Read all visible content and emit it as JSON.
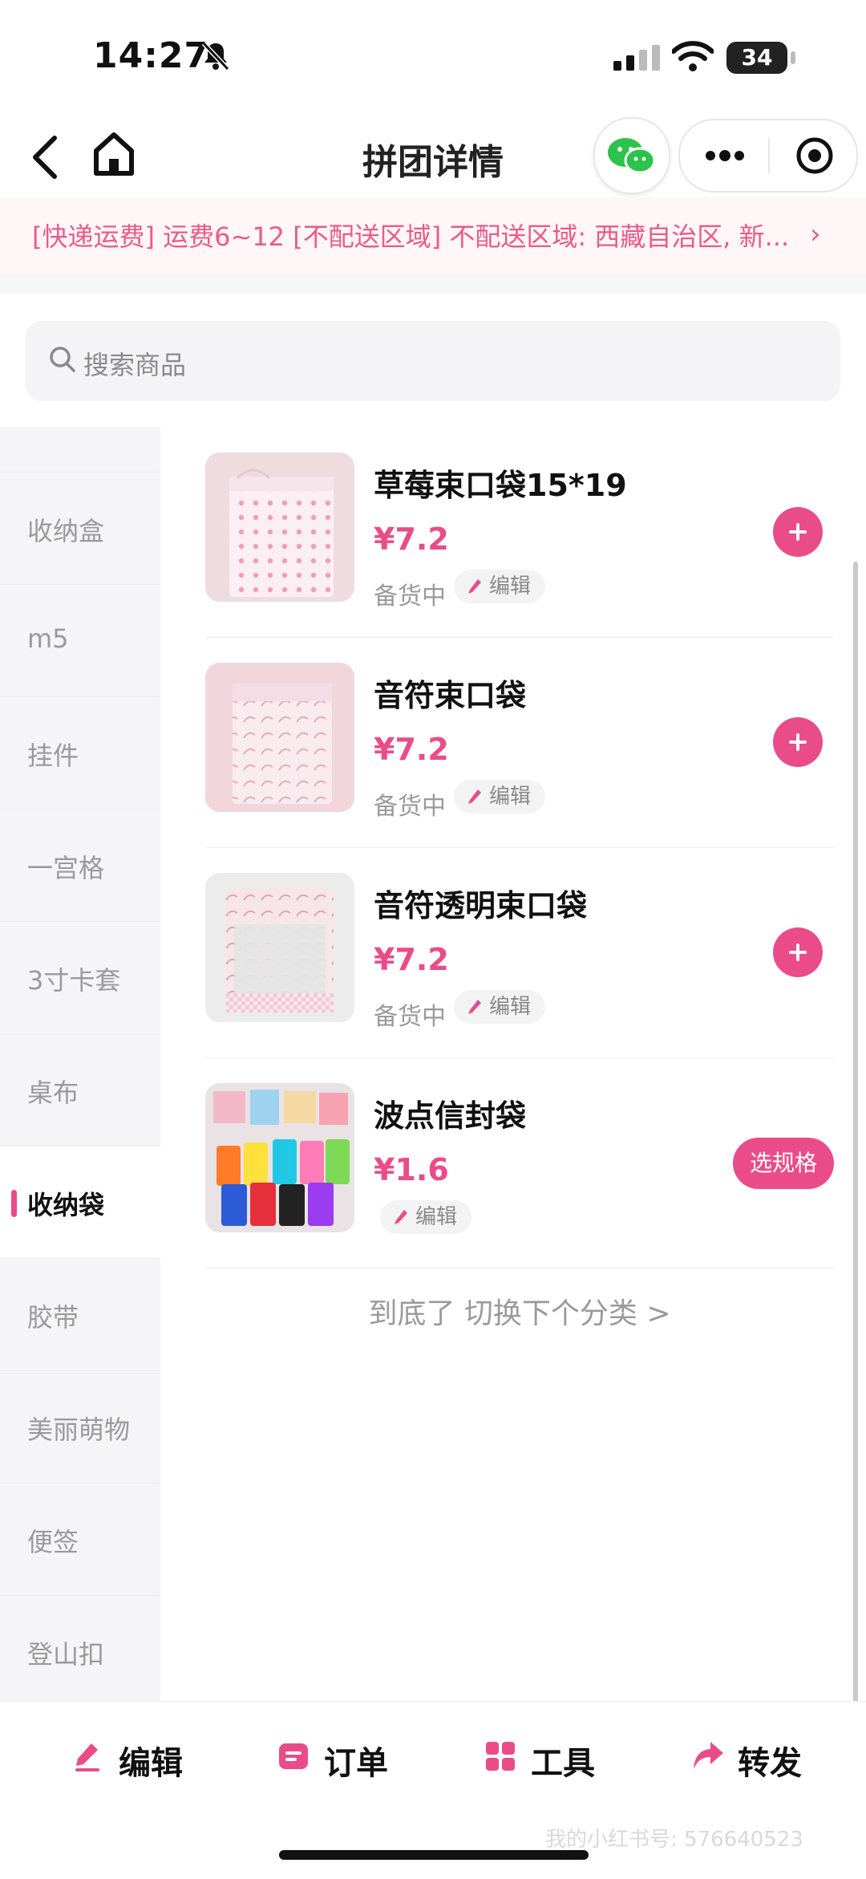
{
  "status_bar": {
    "time": "14:27",
    "battery": "34"
  },
  "nav": {
    "title": "拼团详情"
  },
  "notice": {
    "text": "[快递运费] 运费6~12 [不配送区域] 不配送区域: 西藏自治区, 新..."
  },
  "search": {
    "placeholder": "搜索商品"
  },
  "sidebar": {
    "items": [
      {
        "label": ""
      },
      {
        "label": "收纳盒"
      },
      {
        "label": "m5"
      },
      {
        "label": "挂件"
      },
      {
        "label": "一宫格"
      },
      {
        "label": "3寸卡套"
      },
      {
        "label": "桌布"
      },
      {
        "label": "收纳袋"
      },
      {
        "label": "胶带"
      },
      {
        "label": "美丽萌物"
      },
      {
        "label": "便签"
      },
      {
        "label": "登山扣"
      }
    ],
    "active": "收纳袋"
  },
  "products": [
    {
      "name": "草莓束口袋15*19",
      "price": "¥7.2",
      "stock": "备货中",
      "edit": "编辑"
    },
    {
      "name": "音符束口袋",
      "price": "¥7.2",
      "stock": "备货中",
      "edit": "编辑"
    },
    {
      "name": "音符透明束口袋",
      "price": "¥7.2",
      "stock": "备货中",
      "edit": "编辑"
    },
    {
      "name": "波点信封袋",
      "price": "¥1.6",
      "edit": "编辑",
      "spec_label": "选规格"
    }
  ],
  "end_text": "到底了 切换下个分类 >",
  "bottom": {
    "edit": "编辑",
    "order": "订单",
    "tools": "工具",
    "share": "转发"
  },
  "watermark": "我的小红书号: 576640523",
  "colors": {
    "accent": "#ea4c89",
    "notice_text": "#ea5a8a"
  }
}
